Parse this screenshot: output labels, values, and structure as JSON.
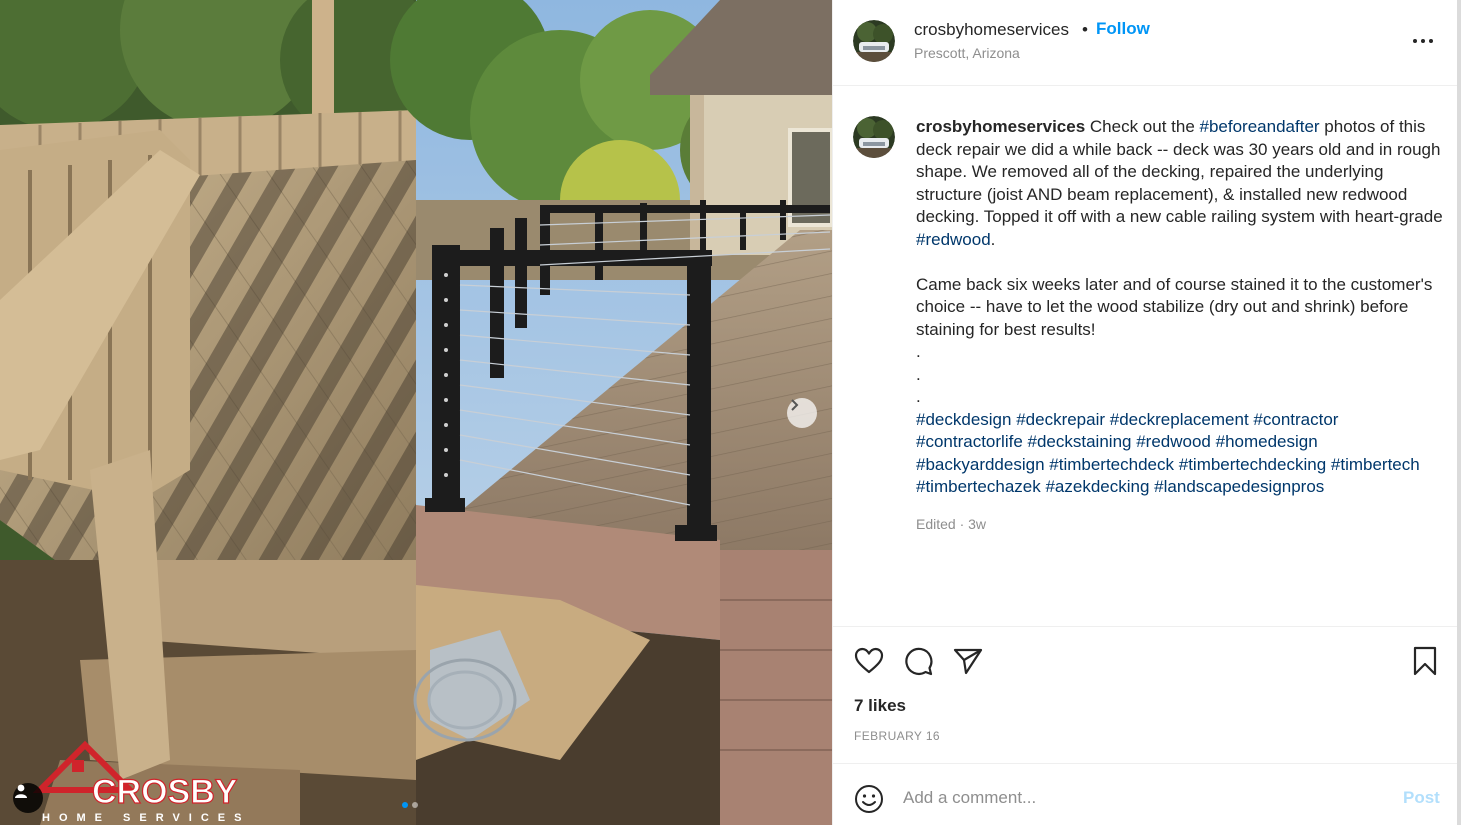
{
  "post": {
    "username": "crosbyhomeservices",
    "bullet": "•",
    "follow_label": "Follow",
    "location": "Prescott, Arizona",
    "caption_lines": [
      [
        {
          "t": "Check out the ",
          "kind": "text"
        },
        {
          "t": "#beforeandafter",
          "kind": "tag"
        },
        {
          "t": " photos of this deck repair we did a while back -- deck was 30 years old and in rough shape. We removed all of the decking, repaired the underlying structure (joist AND beam replacement), & installed new redwood decking. Topped it off with a new cable railing system with heart-grade ",
          "kind": "text"
        },
        {
          "t": "#redwood",
          "kind": "tag"
        },
        {
          "t": ".",
          "kind": "text"
        }
      ]
    ],
    "caption_p2": "Came back six weeks later and of course stained it to the customer's choice -- have to let the wood stabilize (dry out and shrink) before staining for best results!",
    "dots": [
      ".",
      ".",
      "."
    ],
    "hashtags": [
      "#deckdesign",
      "#deckrepair",
      "#deckreplacement",
      "#contractor",
      "#contractorlife",
      "#deckstaining",
      "#redwood",
      "#homedesign",
      "#backyarddesign",
      "#timbertechdeck",
      "#timbertechdecking",
      "#timbertech",
      "#timbertechazek",
      "#azekdecking",
      "#landscapedesignpros"
    ],
    "edited": "Edited · 3w",
    "likes": "7 likes",
    "date": "FEBRUARY 16"
  },
  "comment": {
    "placeholder": "Add a comment...",
    "post_label": "Post"
  },
  "media": {
    "watermark_brand": "CROSBY",
    "watermark_sub": "HOME SERVICES",
    "carousel_total": 2,
    "carousel_index": 1
  },
  "icons": {
    "more": "more-options-icon",
    "like": "heart-icon",
    "comment": "comment-bubble-icon",
    "share": "paper-plane-icon",
    "save": "bookmark-icon",
    "emoji": "smiley-icon",
    "next": "chevron-right-icon",
    "tag": "person-tag-icon"
  },
  "colors": {
    "link_blue": "#0095f6",
    "hashtag": "#00376b",
    "muted": "#8e8e8e",
    "post_disabled": "#b2dffc",
    "watermark_red": "#d0242b"
  }
}
